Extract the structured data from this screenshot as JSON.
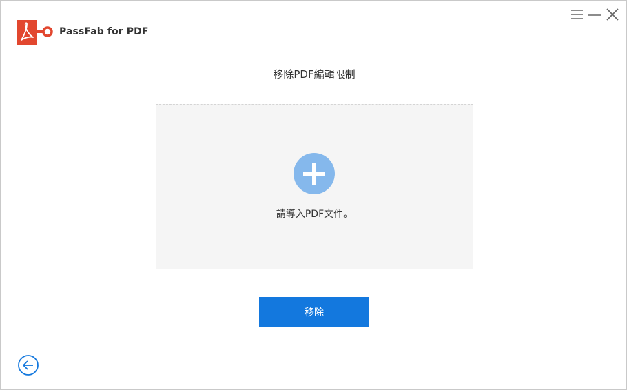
{
  "app": {
    "name": "PassFab for PDF",
    "brand_color": "#e2472f"
  },
  "window_controls": {
    "menu_icon": "hamburger-menu-icon",
    "minimize_icon": "minimize-icon",
    "close_icon": "close-icon"
  },
  "main": {
    "title": "移除PDF編輯限制",
    "drop_zone": {
      "icon": "plus-circle-icon",
      "icon_color": "#85b8ec",
      "hint": "請導入PDF文件。"
    },
    "action_button": {
      "label": "移除",
      "color": "#1378de"
    }
  },
  "footer": {
    "back_icon": "arrow-left-circle-icon",
    "back_color": "#1378de"
  }
}
